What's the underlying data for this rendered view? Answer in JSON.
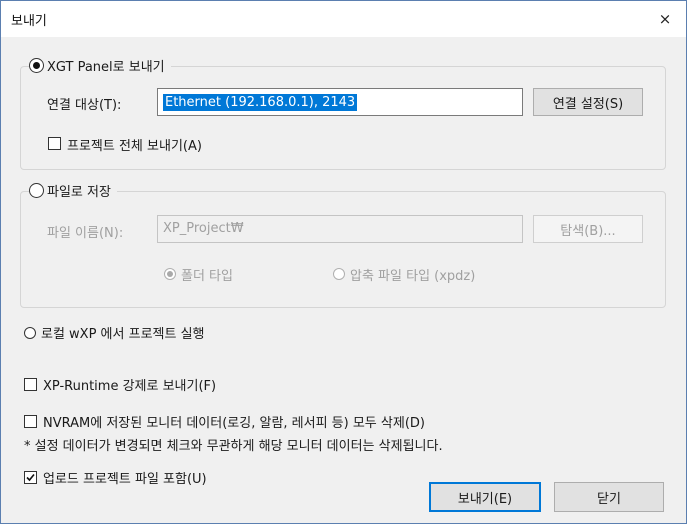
{
  "window": {
    "title": "보내기",
    "close_glyph": "×"
  },
  "panel_group": {
    "label": "XGT Panel로 보내기",
    "target_label": "연결 대상(T):",
    "target_value": "Ethernet (192.168.0.1), 2143",
    "connect_settings_label": "연결 설정(S)",
    "send_all_label": "프로젝트 전체 보내기(A)"
  },
  "file_group": {
    "label": "파일로 저장",
    "filename_label": "파일 이름(N):",
    "filename_value": "XP_Project₩",
    "browse_label": "탐색(B)...",
    "folder_type_label": "폴더 타입",
    "zip_type_label": "압축 파일 타입 (xpdz)"
  },
  "local_run_label": "로컬 wXP 에서 프로젝트 실행",
  "force_send_label": "XP-Runtime 강제로 보내기(F)",
  "nvram_delete_label": "NVRAM에 저장된 모니터 데이터(로깅, 알람, 레서피 등) 모두 삭제(D)",
  "note_text": "* 설정 데이터가 변경되면 체크와 무관하게 해당 모니터 데이터는 삭제됩니다.",
  "include_upload_label": "업로드 프로젝트 파일 포함(U)",
  "send_button_label": "보내기(E)",
  "close_button_label": "닫기",
  "colors": {
    "selection": "#0078d7",
    "border": "#5b7fb0",
    "face": "#f0f0f0"
  }
}
